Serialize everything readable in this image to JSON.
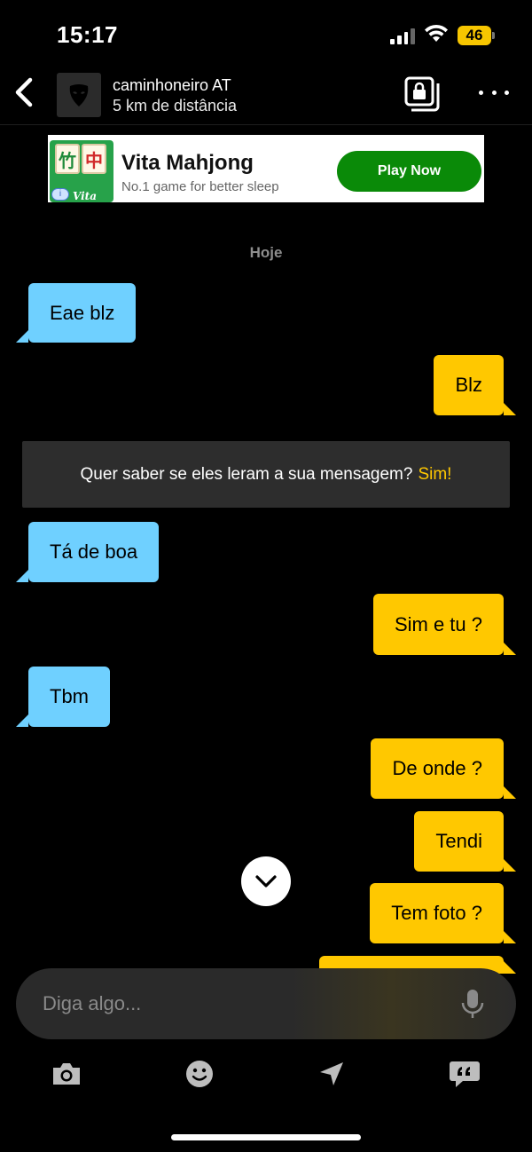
{
  "status_bar": {
    "time": "15:17",
    "battery": "46",
    "icons": [
      "signal-icon",
      "wifi-icon",
      "battery-icon"
    ]
  },
  "header": {
    "name": "caminhoneiro AT",
    "distance": "5 km de distância",
    "icons": [
      "back-chevron-icon",
      "grindr-mask-icon",
      "private-album-icon",
      "more-icon"
    ]
  },
  "ad": {
    "title": "Vita Mahjong",
    "subtitle": "No.1 game for better sleep",
    "button": "Play Now",
    "brand": "Vita",
    "tiles": [
      "竹",
      "中"
    ],
    "button_color": "#0a8a08"
  },
  "chat": {
    "date": "Hoje",
    "messages": [
      {
        "dir": "in",
        "text": "Eae blz"
      },
      {
        "dir": "out",
        "text": "Blz"
      },
      {
        "dir": "in",
        "text": "Tá de boa"
      },
      {
        "dir": "out",
        "text": "Sim e tu ?"
      },
      {
        "dir": "in",
        "text": "Tbm"
      },
      {
        "dir": "out",
        "text": "De onde ?"
      },
      {
        "dir": "out",
        "text": "Tendi"
      },
      {
        "dir": "out",
        "text": "Tem foto ?"
      }
    ],
    "read_banner": {
      "text": "Quer saber se eles leram a sua mensagem?",
      "cta": "Sim!"
    },
    "colors": {
      "incoming": "#6fd0ff",
      "outgoing": "#ffc800"
    }
  },
  "composer": {
    "placeholder": "Diga algo...",
    "toolbar": [
      "camera-icon",
      "emoji-icon",
      "location-icon",
      "saved-phrases-icon"
    ]
  }
}
